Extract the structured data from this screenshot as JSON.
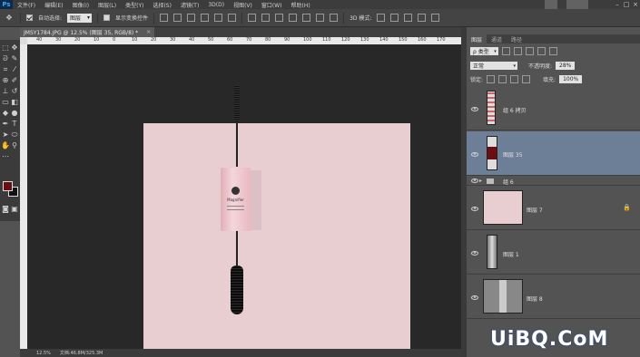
{
  "app": {
    "logo_text": "Ps"
  },
  "menu": {
    "items": [
      "文件(F)",
      "编辑(E)",
      "图像(I)",
      "图层(L)",
      "类型(Y)",
      "选择(S)",
      "滤镜(T)",
      "3D(D)",
      "视图(V)",
      "窗口(W)",
      "帮助(H)"
    ]
  },
  "window_buttons": {
    "minimize": "–",
    "restore": "□",
    "close": "×"
  },
  "options_bar": {
    "auto_select_label": "自动选择:",
    "auto_select_checked": true,
    "auto_select_value": "图层",
    "show_transform_label": "显示变换控件",
    "show_transform_checked": false,
    "mode_label": "3D 模式:"
  },
  "document_tab": {
    "title": "JMSY1784.JPG @ 12.5% (图层 35, RGB/8) *",
    "close": "×"
  },
  "rulers": {
    "h_ticks": [
      "40",
      "30",
      "20",
      "10",
      "0",
      "10",
      "20",
      "30",
      "40",
      "50",
      "60",
      "70",
      "80",
      "90",
      "100",
      "110",
      "120",
      "130",
      "140",
      "150",
      "160",
      "170"
    ]
  },
  "canvas": {
    "background": "#e8cdd1",
    "product_brand": "Magnifier",
    "product_subtext": [
      "AMAZING EYE",
      "LASH"
    ]
  },
  "colors": {
    "foreground": "#6b0e13",
    "background": "#111111",
    "selection": "#6d7f96"
  },
  "status_bar": {
    "zoom": "12.5%",
    "doc": "文档:46.8M/325.3M"
  },
  "layers_panel": {
    "tabs": [
      "图层",
      "通道",
      "路径"
    ],
    "filter_kind": "ρ 类型",
    "blend_mode": "正常",
    "opacity_label": "不透明度:",
    "opacity_value": "28%",
    "lock_label": "锁定:",
    "fill_label": "填充:",
    "fill_value": "100%",
    "layers": [
      {
        "name": "组 6 拷贝",
        "selected": false,
        "type": "smart"
      },
      {
        "name": "图层 35",
        "selected": true,
        "type": "layer"
      },
      {
        "name": "组 6",
        "selected": false,
        "type": "group"
      },
      {
        "name": "图层 7",
        "selected": false,
        "type": "fill",
        "locked": true
      },
      {
        "name": "图层 1",
        "selected": false,
        "type": "layer"
      },
      {
        "name": "图层 8",
        "selected": false,
        "type": "layer"
      }
    ]
  },
  "watermark": "UiBQ.CoM"
}
